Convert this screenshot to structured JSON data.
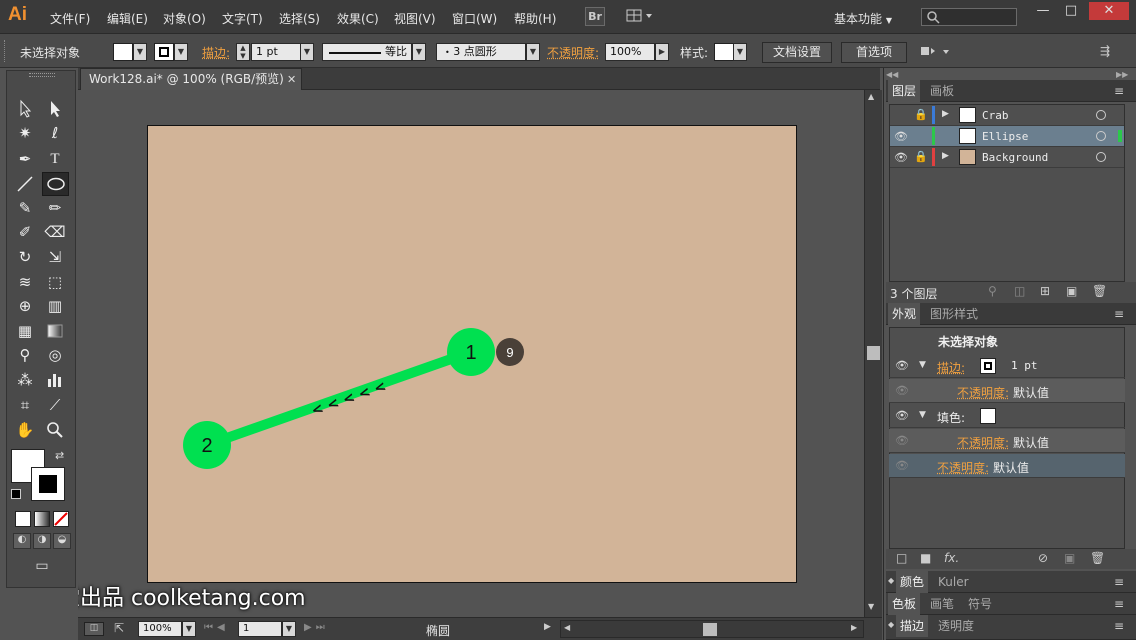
{
  "app": {
    "logo": "Ai",
    "menu": [
      "文件(F)",
      "编辑(E)",
      "对象(O)",
      "文字(T)",
      "选择(S)",
      "效果(C)",
      "视图(V)",
      "窗口(W)",
      "帮助(H)"
    ],
    "bridge_label": "Br",
    "workspace": "基本功能",
    "window_controls": [
      "—",
      "□",
      "✕"
    ]
  },
  "control_bar": {
    "selection_label": "未选择对象",
    "stroke_label": "描边:",
    "stroke_value": "1 pt",
    "stroke_profile": "等比",
    "brush_value": "3 点圆形",
    "opacity_label": "不透明度:",
    "opacity_value": "100%",
    "style_label": "样式:",
    "doc_setup_button": "文档设置",
    "preferences_button": "首选项"
  },
  "document": {
    "tab_title": "Work128.ai* @ 100% (RGB/预览)",
    "close_glyph": "✕"
  },
  "canvas": {
    "artboard_color": "#d2b498",
    "line_color": "#00e050",
    "marker_1": "1",
    "marker_2": "2",
    "step_badge": "9",
    "direction_arrows": "< < < < <"
  },
  "status_bar": {
    "zoom": "100%",
    "page": "1",
    "tool_name": "椭圆"
  },
  "layers_panel": {
    "tabs": [
      "图层",
      "画板"
    ],
    "rows": [
      {
        "name": "Crab",
        "color": "#3b7bd8",
        "locked": true,
        "visible": false,
        "selected": false
      },
      {
        "name": "Ellipse",
        "color": "#2cc84a",
        "locked": false,
        "visible": true,
        "selected": true
      },
      {
        "name": "Background",
        "color": "#e04040",
        "locked": true,
        "visible": true,
        "selected": false
      }
    ],
    "count_label": "3 个图层"
  },
  "appearance_panel": {
    "tabs": [
      "外观",
      "图形样式"
    ],
    "title": "未选择对象",
    "stroke_label": "描边:",
    "stroke_value": "1 pt",
    "opacity_label": "不透明度:",
    "default_value": "默认值",
    "fill_label": "填色:",
    "fx_label": "fx."
  },
  "collapsed_panels": {
    "row1": [
      "颜色",
      "Kuler"
    ],
    "row2": [
      "色板",
      "画笔",
      "符号"
    ],
    "row3": [
      "描边",
      "透明度"
    ]
  },
  "watermark": "酷课堂出品 coolketang.com"
}
